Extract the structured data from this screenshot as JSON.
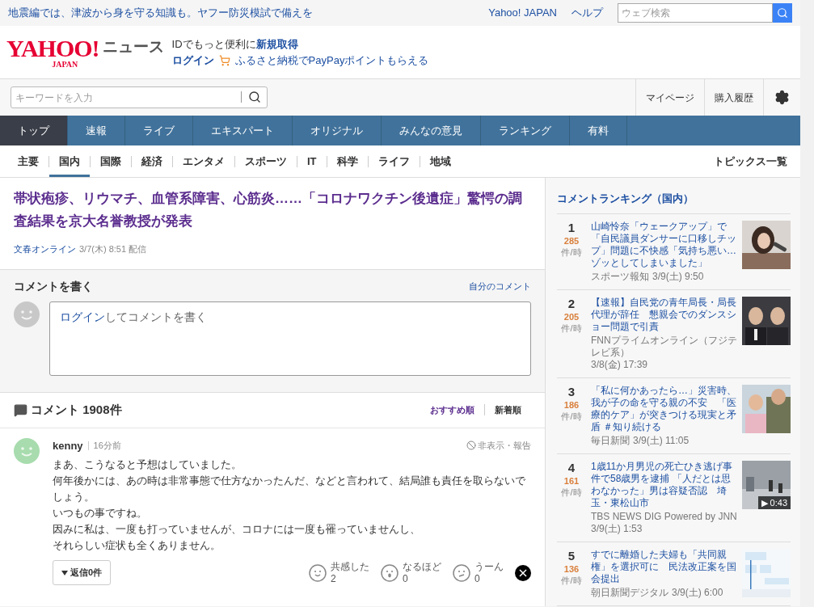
{
  "top_bar": {
    "notice": "地震編では、津波から身を守る知識も。ヤフー防災模試で備えを",
    "links": [
      "Yahoo! JAPAN",
      "ヘルプ"
    ],
    "search_placeholder": "ウェブ検索"
  },
  "header": {
    "logo_main": "YAHOO!",
    "logo_sub": "JAPAN",
    "logo_suffix": "ニュース",
    "promo_prefix": "IDでもっと便利に",
    "promo_link": "新規取得",
    "login": "ログイン",
    "promo_2": "ふるさと納税でPayPayポイントもらえる"
  },
  "toolbar": {
    "search_placeholder": "キーワードを入力",
    "links": [
      "マイページ",
      "購入履歴"
    ]
  },
  "nav": [
    {
      "label": "トップ",
      "selected": true
    },
    {
      "label": "速報",
      "selected": false
    },
    {
      "label": "ライブ",
      "selected": false
    },
    {
      "label": "エキスパート",
      "selected": false
    },
    {
      "label": "オリジナル",
      "selected": false
    },
    {
      "label": "みんなの意見",
      "selected": false
    },
    {
      "label": "ランキング",
      "selected": false
    },
    {
      "label": "有料",
      "selected": false
    }
  ],
  "subnav": {
    "items": [
      {
        "label": "主要",
        "selected": false
      },
      {
        "label": "国内",
        "selected": true
      },
      {
        "label": "国際",
        "selected": false
      },
      {
        "label": "経済",
        "selected": false
      },
      {
        "label": "エンタメ",
        "selected": false
      },
      {
        "label": "スポーツ",
        "selected": false
      },
      {
        "label": "IT",
        "selected": false
      },
      {
        "label": "科学",
        "selected": false
      },
      {
        "label": "ライフ",
        "selected": false
      },
      {
        "label": "地域",
        "selected": false
      }
    ],
    "topics_link": "トピックス一覧"
  },
  "article": {
    "title": "帯状疱疹、リウマチ、血管系障害、心筋炎……「コロナワクチン後遺症」驚愕の調査結果を京大名誉教授が発表",
    "source": "文春オンライン",
    "date": "3/7(木) 8:51 配信"
  },
  "comment_form": {
    "heading": "コメントを書く",
    "my_comments": "自分のコメント",
    "login_link": "ログイン",
    "prompt": "してコメントを書く"
  },
  "comments": {
    "count_label": "コメント 1908件",
    "sort": [
      {
        "label": "おすすめ順",
        "selected": true
      },
      {
        "label": "新着順",
        "selected": false
      }
    ],
    "items": [
      {
        "user": "kenny",
        "time": "16分前",
        "hide_report": "非表示・報告",
        "lines": [
          "まあ、こうなると予想はしていました。",
          "何年後かには、あの時は非常事態で仕方なかったんだ、などと言われて、結局誰も責任を取らないでしょう。",
          "いつもの事ですね。",
          "因みに私は、一度も打っていませんが、コロナには一度も罹っていませんし、",
          "それらしい症状も全くありません。"
        ],
        "replies": "返信0件",
        "reactions": [
          {
            "kind": "smile",
            "label": "共感した",
            "count": "2"
          },
          {
            "kind": "surprised",
            "label": "なるほど",
            "count": "0"
          },
          {
            "kind": "thinking",
            "label": "うーん",
            "count": "0"
          }
        ]
      }
    ]
  },
  "ranking": {
    "title": "コメントランキング（国内）",
    "items": [
      {
        "rank": "1",
        "count": "285",
        "unit": "件/時",
        "headline": "山崎怜奈「ウェークアップ」で「自民議員ダンサーに口移しチップ」問題に不快感「気持ち悪い…ゾッとしてしまいました」",
        "source": "スポーツ報知",
        "time": "3/9(土) 9:50"
      },
      {
        "rank": "2",
        "count": "205",
        "unit": "件/時",
        "headline": "【速報】自民党の青年局長・局長代理が辞任　懇親会でのダンスショー問題で引責",
        "source": "FNNプライムオンライン（フジテレビ系）",
        "time": "3/8(金) 17:39"
      },
      {
        "rank": "3",
        "count": "186",
        "unit": "件/時",
        "headline": "「私に何かあったら…」災害時、我が子の命を守る親の不安　「医療的ケア」が突きつける現実と矛盾 ＃知り続ける",
        "source": "毎日新聞",
        "time": "3/9(土) 11:05"
      },
      {
        "rank": "4",
        "count": "161",
        "unit": "件/時",
        "headline": "1歳11か月男児の死亡ひき逃げ事件で58歳男を逮捕 「人だとは思わなかった」男は容疑否認　埼玉・東松山市",
        "source": "TBS NEWS DIG Powered by JNN",
        "time": "3/9(土) 1:53",
        "duration": "▶ 0:43"
      },
      {
        "rank": "5",
        "count": "136",
        "unit": "件/時",
        "headline": "すでに離婚した夫婦も「共同親権」を選択可に　民法改正案を国会提出",
        "source": "朝日新聞デジタル",
        "time": "3/9(土) 6:00"
      }
    ]
  }
}
